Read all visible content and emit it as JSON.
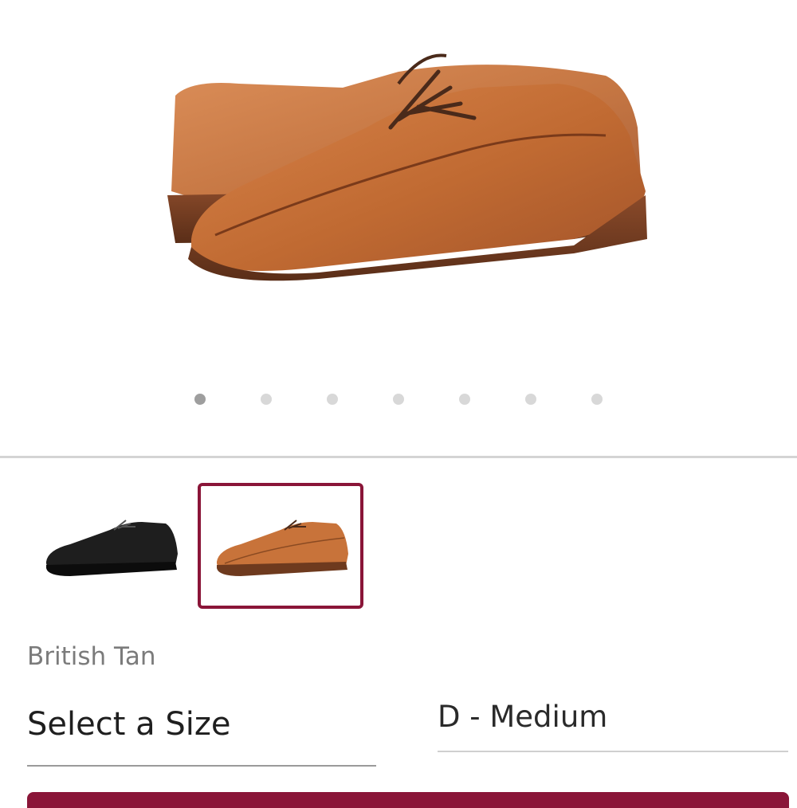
{
  "product": {
    "color_name": "British Tan",
    "gallery": {
      "total_images": 7,
      "active_index": 0
    },
    "swatches": [
      {
        "name": "black-swatch",
        "selected": false
      },
      {
        "name": "tan-swatch",
        "selected": true
      }
    ]
  },
  "size_selector": {
    "label": "Select a Size"
  },
  "width_selector": {
    "value": "D - Medium"
  },
  "colors": {
    "accent": "#8a1538",
    "shoe_tan": "#c8733a",
    "divider": "#d4d4d4"
  }
}
